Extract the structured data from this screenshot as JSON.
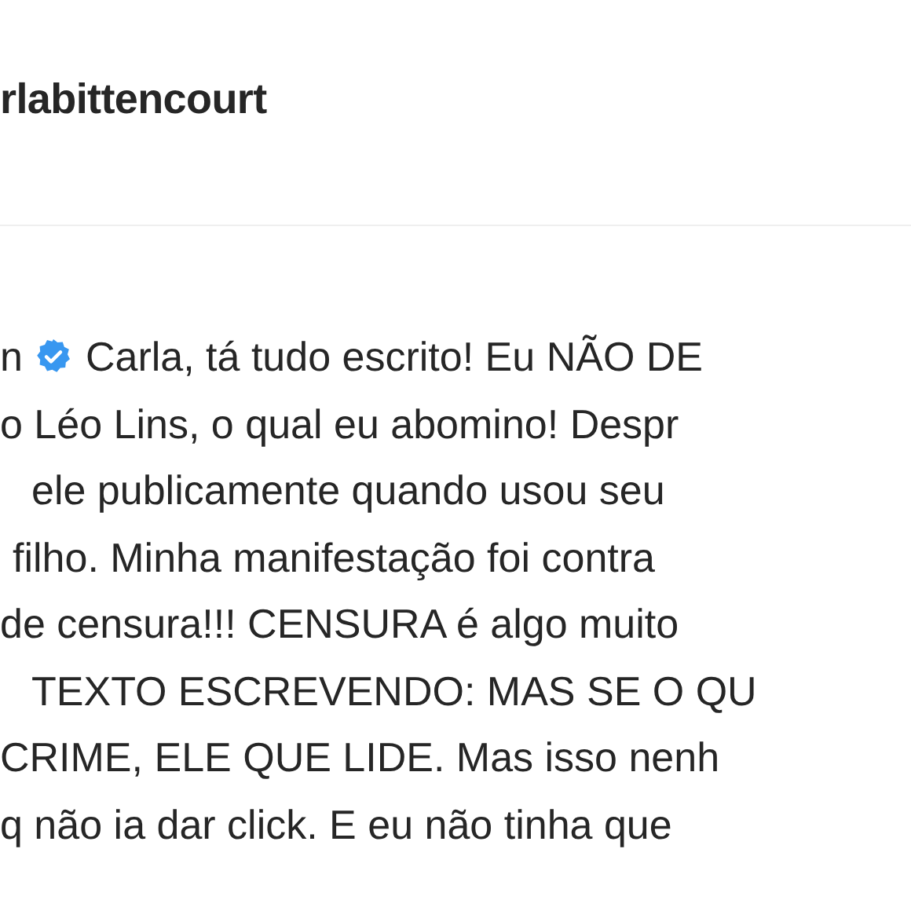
{
  "header": {
    "username": "rlabittencourt"
  },
  "comment": {
    "author_fragment": "n",
    "verified": true,
    "lines": [
      "Carla, tá tudo escrito! Eu NÃO DE",
      "o Léo Lins, o qual eu abomino! Despr",
      "ele publicamente quando usou seu",
      "filho. Minha manifestação foi contra",
      "de censura!!! CENSURA é algo muito",
      "TEXTO ESCREVENDO: MAS SE O QU",
      "CRIME, ELE QUE LIDE. Mas isso nenh",
      "q não ia dar click. E eu não tinha que"
    ]
  }
}
